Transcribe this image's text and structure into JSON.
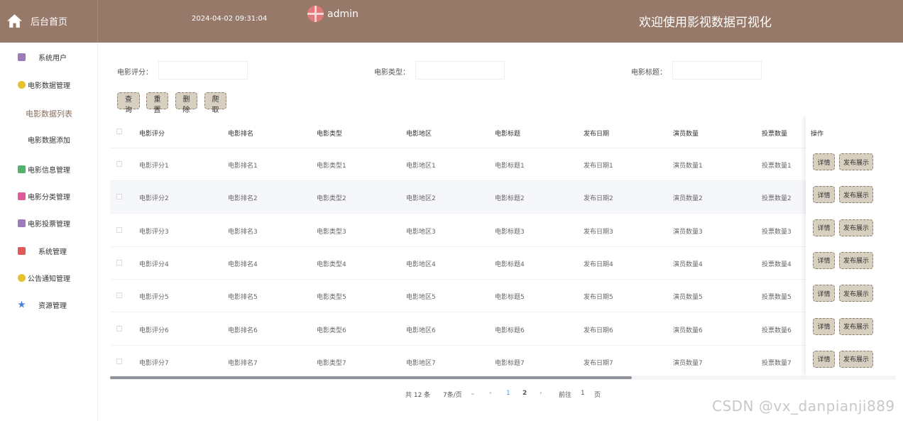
{
  "header": {
    "home_label": "后台首页",
    "datetime": "2024-04-02 09:31:04",
    "username": "admin",
    "welcome": "欢迎使用影视数据可视化"
  },
  "sidebar": {
    "items": [
      {
        "label": "系统用户",
        "icon": "user-icon",
        "color": "#9b7bb8"
      },
      {
        "label": "电影数据管理",
        "icon": "film-icon",
        "color": "#e6c02f"
      },
      {
        "label": "电影数据列表",
        "icon": "",
        "color": ""
      },
      {
        "label": "电影数据添加",
        "icon": "",
        "color": ""
      },
      {
        "label": "电影信息管理",
        "icon": "info-icon",
        "color": "#52b36b"
      },
      {
        "label": "电影分类管理",
        "icon": "category-icon",
        "color": "#e05a9a"
      },
      {
        "label": "电影投票管理",
        "icon": "vote-icon",
        "color": "#9b7bb8"
      },
      {
        "label": "系统管理",
        "icon": "settings-icon",
        "color": "#e05a5a"
      },
      {
        "label": "公告通知管理",
        "icon": "notice-icon",
        "color": "#e6c02f"
      },
      {
        "label": "资源管理",
        "icon": "resource-icon",
        "color": "#4a7fe0"
      }
    ]
  },
  "search": {
    "score_label": "电影评分：",
    "type_label": "电影类型：",
    "title_label": "电影标题：",
    "score_value": "",
    "type_value": "",
    "title_value": ""
  },
  "actions": {
    "query": "查询",
    "reset": "重置",
    "delete": "删除",
    "crawl": "爬取"
  },
  "table": {
    "headers": [
      "电影评分",
      "电影排名",
      "电影类型",
      "电影地区",
      "电影标题",
      "发布日期",
      "演员数量",
      "投票数量",
      "操作"
    ],
    "rows": [
      [
        "电影评分1",
        "电影排名1",
        "电影类型1",
        "电影地区1",
        "电影标题1",
        "发布日期1",
        "演员数量1",
        "投票数量1"
      ],
      [
        "电影评分2",
        "电影排名2",
        "电影类型2",
        "电影地区2",
        "电影标题2",
        "发布日期2",
        "演员数量2",
        "投票数量2"
      ],
      [
        "电影评分3",
        "电影排名3",
        "电影类型3",
        "电影地区3",
        "电影标题3",
        "发布日期3",
        "演员数量3",
        "投票数量3"
      ],
      [
        "电影评分4",
        "电影排名4",
        "电影类型4",
        "电影地区4",
        "电影标题4",
        "发布日期4",
        "演员数量4",
        "投票数量4"
      ],
      [
        "电影评分5",
        "电影排名5",
        "电影类型5",
        "电影地区5",
        "电影标题5",
        "发布日期5",
        "演员数量5",
        "投票数量5"
      ],
      [
        "电影评分6",
        "电影排名6",
        "电影类型6",
        "电影地区6",
        "电影标题6",
        "发布日期6",
        "演员数量6",
        "投票数量6"
      ],
      [
        "电影评分7",
        "电影排名7",
        "电影类型7",
        "电影地区7",
        "电影标题7",
        "发布日期7",
        "演员数量7",
        "投票数量7"
      ]
    ],
    "row_actions": {
      "detail": "详情",
      "publish": "发布展示"
    }
  },
  "pagination": {
    "total": "共 12 条",
    "page_size": "7条/页",
    "pages": [
      "1",
      "2"
    ],
    "goto_prefix": "前往",
    "goto_value": "1",
    "goto_suffix": "页"
  },
  "watermark": "CSDN @vx_danpianji889",
  "colors": {
    "header_bg": "#967969",
    "button_bg": "#d7cfc0",
    "active_page": "#409eff"
  }
}
